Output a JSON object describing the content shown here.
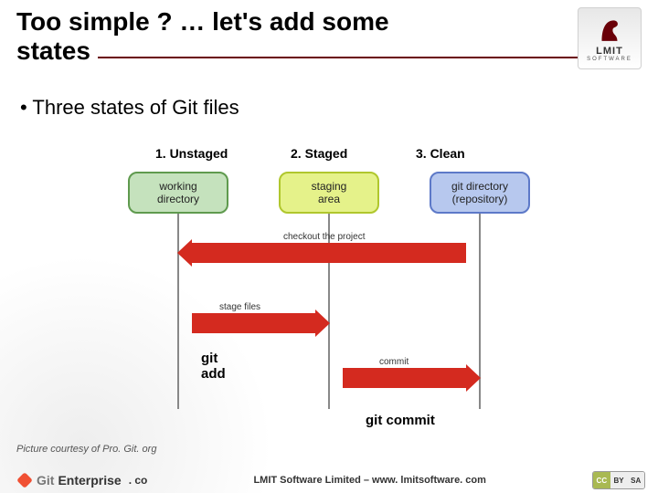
{
  "title": {
    "line1": "Too simple ? … let's add some",
    "line2": "states"
  },
  "brand_logo": {
    "name": "LMIT",
    "sub": "SOFTWARE"
  },
  "bullet_1": "Three states of Git files",
  "states": {
    "col1_label": "1. Unstaged",
    "col2_label": "2. Staged",
    "col3_label": "3. Clean"
  },
  "diagram": {
    "box_working": "working\ndirectory",
    "box_staging": "staging\narea",
    "box_repo": "git directory\n(repository)",
    "arrow_checkout": "checkout the project",
    "arrow_stage": "stage files",
    "arrow_commit": "commit"
  },
  "cmd_add": "git\nadd",
  "cmd_commit": "git commit",
  "courtesy": "Picture courtesy of Pro. Git. org",
  "footer": {
    "git": "Git",
    "enterprise": "Enterprise",
    "dotcom": ". co",
    "center": "LMIT Software Limited – www. lmitsoftware. com",
    "cc1": "CC",
    "cc2": "BY",
    "cc3": "SA"
  }
}
